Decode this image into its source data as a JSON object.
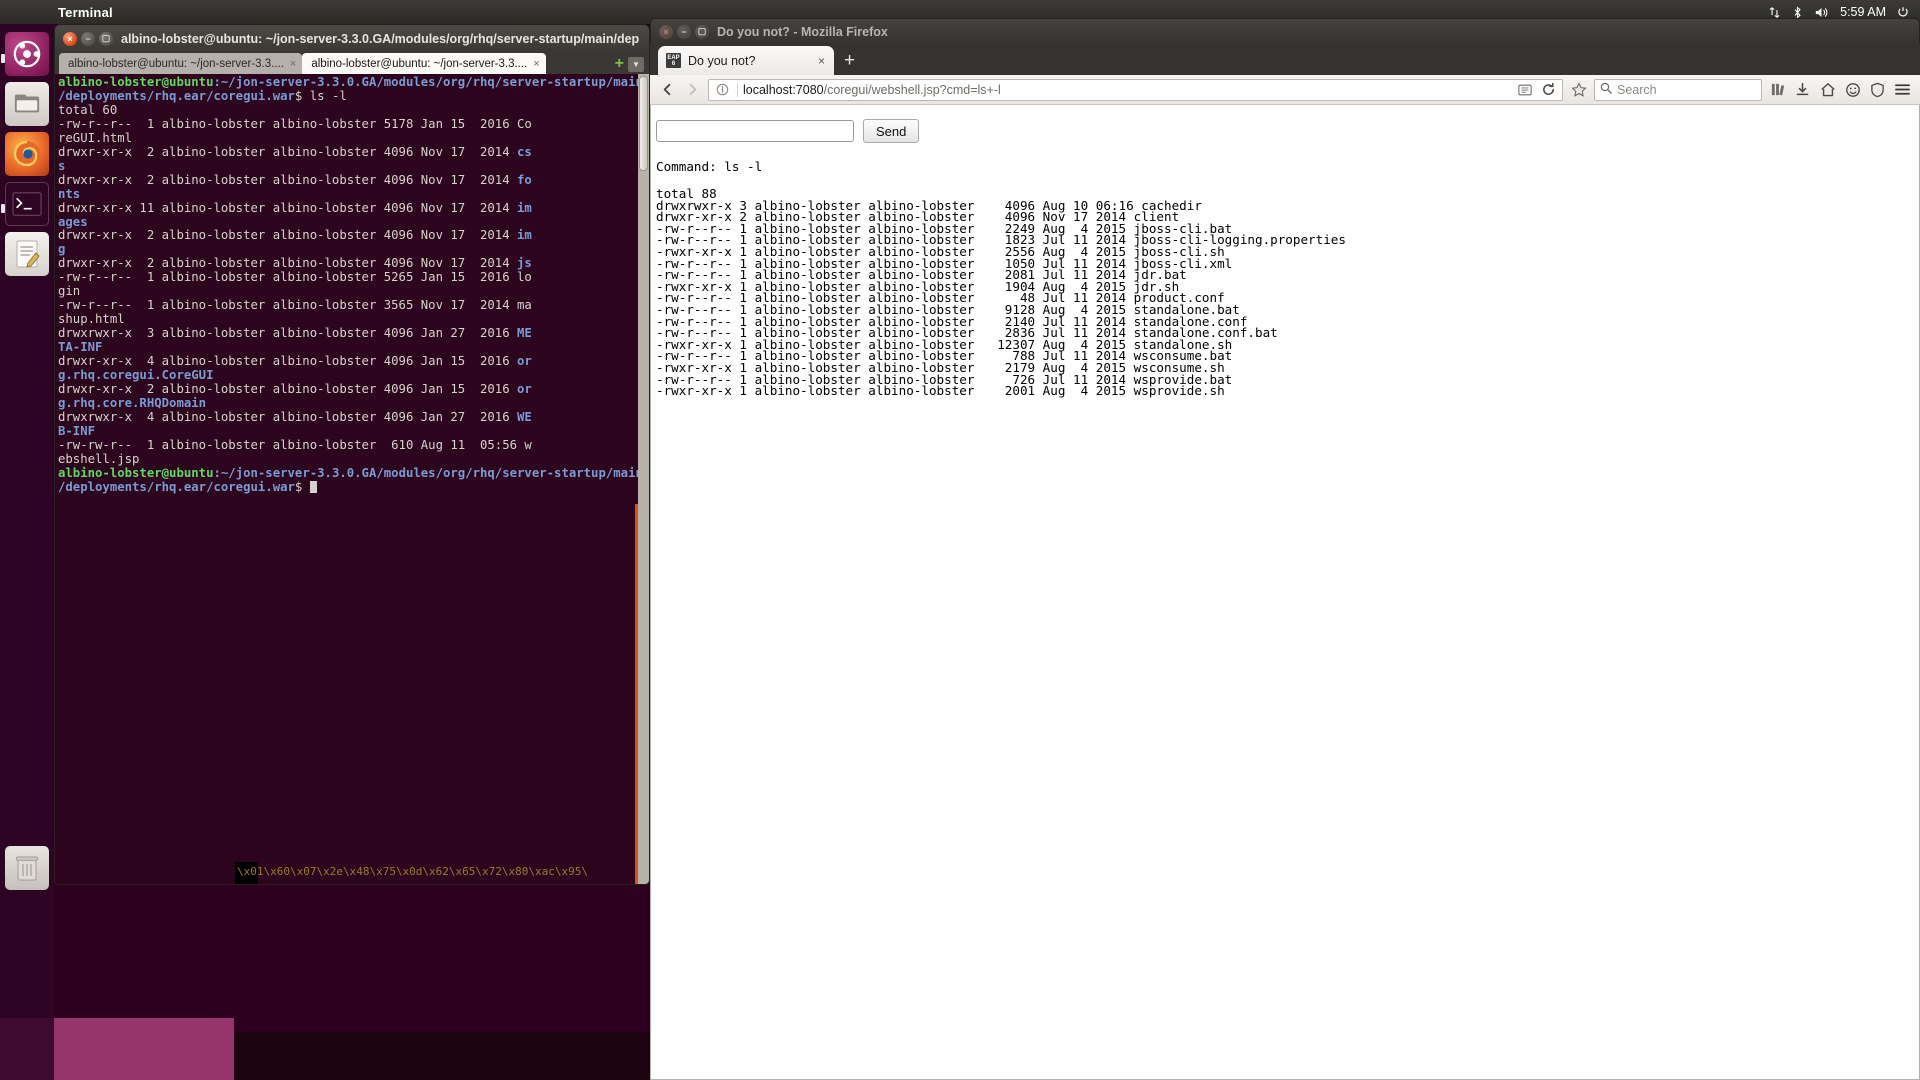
{
  "panel": {
    "app_name": "Terminal",
    "clock": "5:59 AM",
    "indicators": [
      {
        "name": "network-icon",
        "glyph": "⇅"
      },
      {
        "name": "bluetooth-icon",
        "glyph": "ᛦ"
      },
      {
        "name": "volume-icon",
        "glyph": "🔊"
      },
      {
        "name": "power-icon",
        "glyph": "⏻"
      }
    ]
  },
  "launcher": {
    "items": [
      {
        "name": "ubuntu-dash-icon",
        "label": "Dash home",
        "glyph": ""
      },
      {
        "name": "files-icon",
        "label": "Files",
        "glyph": "🗀"
      },
      {
        "name": "firefox-icon",
        "label": "Firefox",
        "glyph": "●"
      },
      {
        "name": "terminal-icon",
        "label": "Terminal",
        "glyph": ">_"
      },
      {
        "name": "text-editor-icon",
        "label": "Text Editor",
        "glyph": "✎"
      },
      {
        "name": "trash-icon",
        "label": "Trash",
        "glyph": "🗑"
      }
    ]
  },
  "terminal": {
    "window_title": "albino-lobster@ubuntu: ~/jon-server-3.3.0.GA/modules/org/rhq/server-startup/main/dep",
    "tabs": [
      {
        "label": "albino-lobster@ubuntu: ~/jon-server-3.3....",
        "close": "×",
        "active": false
      },
      {
        "label": "albino-lobster@ubuntu: ~/jon-server-3.3....",
        "close": "×",
        "active": true
      }
    ],
    "new_tab_label": "+",
    "tab_list_label": "▼",
    "prompt_user": "albino-lobster@ubuntu",
    "prompt_path_line1": ":~/jon-server-3.3.0.GA/modules/org/rhq/server-startup/main",
    "prompt_path_line2": "/deployments/rhq.ear/coregui.war",
    "prompt_symbol": "$ ",
    "command": "ls -l",
    "total_line": "total 60",
    "listing": [
      {
        "perm": "-rw-r--r--",
        "links": "1",
        "owner": "albino-lobster",
        "group": "albino-lobster",
        "size": "5178",
        "month": "Jan",
        "day": "15",
        "year": "2016",
        "name": "CoreGUI.html",
        "kind": "file"
      },
      {
        "perm": "drwxr-xr-x",
        "links": "2",
        "owner": "albino-lobster",
        "group": "albino-lobster",
        "size": "4096",
        "month": "Nov",
        "day": "17",
        "year": "2014",
        "name": "css",
        "kind": "dir"
      },
      {
        "perm": "drwxr-xr-x",
        "links": "2",
        "owner": "albino-lobster",
        "group": "albino-lobster",
        "size": "4096",
        "month": "Nov",
        "day": "17",
        "year": "2014",
        "name": "fonts",
        "kind": "dir"
      },
      {
        "perm": "drwxr-xr-x",
        "links": "11",
        "owner": "albino-lobster",
        "group": "albino-lobster",
        "size": "4096",
        "month": "Nov",
        "day": "17",
        "year": "2014",
        "name": "images",
        "kind": "dir"
      },
      {
        "perm": "drwxr-xr-x",
        "links": "2",
        "owner": "albino-lobster",
        "group": "albino-lobster",
        "size": "4096",
        "month": "Nov",
        "day": "17",
        "year": "2014",
        "name": "img",
        "kind": "dir"
      },
      {
        "perm": "drwxr-xr-x",
        "links": "2",
        "owner": "albino-lobster",
        "group": "albino-lobster",
        "size": "4096",
        "month": "Nov",
        "day": "17",
        "year": "2014",
        "name": "js",
        "kind": "dir"
      },
      {
        "perm": "-rw-r--r--",
        "links": "1",
        "owner": "albino-lobster",
        "group": "albino-lobster",
        "size": "5265",
        "month": "Jan",
        "day": "15",
        "year": "2016",
        "name": "login",
        "kind": "file"
      },
      {
        "perm": "-rw-r--r--",
        "links": "1",
        "owner": "albino-lobster",
        "group": "albino-lobster",
        "size": "3565",
        "month": "Nov",
        "day": "17",
        "year": "2014",
        "name": "mashup.html",
        "kind": "file"
      },
      {
        "perm": "drwxrwxr-x",
        "links": "3",
        "owner": "albino-lobster",
        "group": "albino-lobster",
        "size": "4096",
        "month": "Jan",
        "day": "27",
        "year": "2016",
        "name": "META-INF",
        "kind": "dir"
      },
      {
        "perm": "drwxr-xr-x",
        "links": "4",
        "owner": "albino-lobster",
        "group": "albino-lobster",
        "size": "4096",
        "month": "Jan",
        "day": "15",
        "year": "2016",
        "name": "org.rhq.coregui.CoreGUI",
        "kind": "dir"
      },
      {
        "perm": "drwxr-xr-x",
        "links": "2",
        "owner": "albino-lobster",
        "group": "albino-lobster",
        "size": "4096",
        "month": "Jan",
        "day": "15",
        "year": "2016",
        "name": "org.rhq.core.RHQDomain",
        "kind": "dir"
      },
      {
        "perm": "drwxrwxr-x",
        "links": "4",
        "owner": "albino-lobster",
        "group": "albino-lobster",
        "size": "4096",
        "month": "Jan",
        "day": "27",
        "year": "2016",
        "name": "WEB-INF",
        "kind": "dir"
      },
      {
        "perm": "-rw-rw-r--",
        "links": "1",
        "owner": "albino-lobster",
        "group": "albino-lobster",
        "size": "610",
        "month": "Aug",
        "day": "11",
        "year": "05:56",
        "name": "webshell.jsp",
        "kind": "file"
      }
    ],
    "hexdump": "\\x01\\x60\\x07\\x2e\\x48\\x75\\x0d\\x62\\x65\\x72\\x80\\xac\\x95\\"
  },
  "firefox": {
    "window_title": "Do you not? - Mozilla Firefox",
    "tab": {
      "favicon": "EAP6",
      "label": "Do you not?",
      "close": "×"
    },
    "new_tab_label": "+",
    "nav": {
      "back": "‹",
      "forward": "›",
      "reload": "↻",
      "identity": "ⓘ",
      "reader": "▣",
      "bookmark_star": "☆",
      "library": "Ὅ1",
      "downloads": "↓",
      "home": "⌂",
      "smiley": "☺",
      "shield": "⛉",
      "menu": "≡"
    },
    "url": {
      "host": "localhost:7080",
      "rest": "/coregui/webshell.jsp?cmd=ls+-l"
    },
    "search": {
      "placeholder": "Search",
      "icon": "🔍"
    },
    "page": {
      "input_value": "",
      "send_label": "Send",
      "command_echo": "Command: ls -l",
      "total_line": "total 88",
      "listing": [
        {
          "perm": "drwxrwxr-x",
          "links": "3",
          "owner": "albino-lobster",
          "group": "albino-lobster",
          "size": "4096",
          "month": "Aug",
          "day": "10",
          "year": "06:16",
          "name": "cachedir"
        },
        {
          "perm": "drwxr-xr-x",
          "links": "2",
          "owner": "albino-lobster",
          "group": "albino-lobster",
          "size": "4096",
          "month": "Nov",
          "day": "17",
          "year": "2014",
          "name": "client"
        },
        {
          "perm": "-rw-r--r--",
          "links": "1",
          "owner": "albino-lobster",
          "group": "albino-lobster",
          "size": "2249",
          "month": "Aug",
          "day": "4",
          "year": "2015",
          "name": "jboss-cli.bat"
        },
        {
          "perm": "-rw-r--r--",
          "links": "1",
          "owner": "albino-lobster",
          "group": "albino-lobster",
          "size": "1823",
          "month": "Jul",
          "day": "11",
          "year": "2014",
          "name": "jboss-cli-logging.properties"
        },
        {
          "perm": "-rwxr-xr-x",
          "links": "1",
          "owner": "albino-lobster",
          "group": "albino-lobster",
          "size": "2556",
          "month": "Aug",
          "day": "4",
          "year": "2015",
          "name": "jboss-cli.sh"
        },
        {
          "perm": "-rw-r--r--",
          "links": "1",
          "owner": "albino-lobster",
          "group": "albino-lobster",
          "size": "1050",
          "month": "Jul",
          "day": "11",
          "year": "2014",
          "name": "jboss-cli.xml"
        },
        {
          "perm": "-rw-r--r--",
          "links": "1",
          "owner": "albino-lobster",
          "group": "albino-lobster",
          "size": "2081",
          "month": "Jul",
          "day": "11",
          "year": "2014",
          "name": "jdr.bat"
        },
        {
          "perm": "-rwxr-xr-x",
          "links": "1",
          "owner": "albino-lobster",
          "group": "albino-lobster",
          "size": "1904",
          "month": "Aug",
          "day": "4",
          "year": "2015",
          "name": "jdr.sh"
        },
        {
          "perm": "-rw-r--r--",
          "links": "1",
          "owner": "albino-lobster",
          "group": "albino-lobster",
          "size": "48",
          "month": "Jul",
          "day": "11",
          "year": "2014",
          "name": "product.conf"
        },
        {
          "perm": "-rw-r--r--",
          "links": "1",
          "owner": "albino-lobster",
          "group": "albino-lobster",
          "size": "9128",
          "month": "Aug",
          "day": "4",
          "year": "2015",
          "name": "standalone.bat"
        },
        {
          "perm": "-rw-r--r--",
          "links": "1",
          "owner": "albino-lobster",
          "group": "albino-lobster",
          "size": "2140",
          "month": "Jul",
          "day": "11",
          "year": "2014",
          "name": "standalone.conf"
        },
        {
          "perm": "-rw-r--r--",
          "links": "1",
          "owner": "albino-lobster",
          "group": "albino-lobster",
          "size": "2836",
          "month": "Jul",
          "day": "11",
          "year": "2014",
          "name": "standalone.conf.bat"
        },
        {
          "perm": "-rwxr-xr-x",
          "links": "1",
          "owner": "albino-lobster",
          "group": "albino-lobster",
          "size": "12307",
          "month": "Aug",
          "day": "4",
          "year": "2015",
          "name": "standalone.sh"
        },
        {
          "perm": "-rw-r--r--",
          "links": "1",
          "owner": "albino-lobster",
          "group": "albino-lobster",
          "size": "788",
          "month": "Jul",
          "day": "11",
          "year": "2014",
          "name": "wsconsume.bat"
        },
        {
          "perm": "-rwxr-xr-x",
          "links": "1",
          "owner": "albino-lobster",
          "group": "albino-lobster",
          "size": "2179",
          "month": "Aug",
          "day": "4",
          "year": "2015",
          "name": "wsconsume.sh"
        },
        {
          "perm": "-rw-r--r--",
          "links": "1",
          "owner": "albino-lobster",
          "group": "albino-lobster",
          "size": "726",
          "month": "Jul",
          "day": "11",
          "year": "2014",
          "name": "wsprovide.bat"
        },
        {
          "perm": "-rwxr-xr-x",
          "links": "1",
          "owner": "albino-lobster",
          "group": "albino-lobster",
          "size": "2001",
          "month": "Aug",
          "day": "4",
          "year": "2015",
          "name": "wsprovide.sh"
        }
      ]
    }
  },
  "colors": {
    "terminal_bg": "#2c041e",
    "terminal_fg": "#d8d2cc",
    "prompt_green": "#61d761",
    "dir_blue": "#7b9bd2",
    "ubuntu_orange": "#dd4814",
    "panel_bg": "#3c3b37"
  }
}
